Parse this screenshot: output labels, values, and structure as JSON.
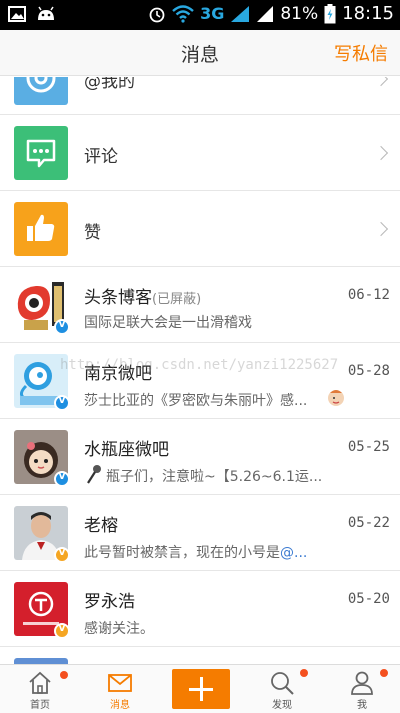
{
  "status_bar": {
    "network": "3G",
    "battery": "81%",
    "time": "18:15"
  },
  "header": {
    "title": "消息",
    "compose_label": "写私信"
  },
  "system_items": [
    {
      "label": "@我的",
      "icon": "at-icon",
      "color": "#5aaee3"
    },
    {
      "label": "评论",
      "icon": "comment-icon",
      "color": "#3cbf78"
    },
    {
      "label": "赞",
      "icon": "thumbs-up-icon",
      "color": "#f7a21b"
    }
  ],
  "conversations": [
    {
      "name": "头条博客",
      "status": "(已屏蔽)",
      "date": "06-12",
      "preview": "国际足联大会是一出滑稽戏"
    },
    {
      "name": "南京微吧",
      "date": "05-28",
      "preview": "莎士比亚的《罗密欧与朱丽叶》感..."
    },
    {
      "name": "水瓶座微吧",
      "date": "05-25",
      "preview": "瓶子们，注意啦~【5.26~6.1运..."
    },
    {
      "name": "老榕",
      "date": "05-22",
      "preview": "此号暂时被禁言，现在的小号是",
      "preview_link": "@..."
    },
    {
      "name": "罗永浩",
      "date": "05-20",
      "preview": "感谢关注。"
    }
  ],
  "watermark": "http://blog.csdn.net/yanzi1225627",
  "tabs": [
    {
      "label": "首页",
      "icon": "home-icon"
    },
    {
      "label": "消息",
      "icon": "mail-icon"
    },
    {
      "label": "发现",
      "icon": "search-icon"
    },
    {
      "label": "我",
      "icon": "profile-icon"
    }
  ],
  "colors": {
    "accent": "#f57c00",
    "badge_blue": "#1e8fe1",
    "badge_yellow": "#f5a623",
    "notify_dot": "#f4501f"
  }
}
